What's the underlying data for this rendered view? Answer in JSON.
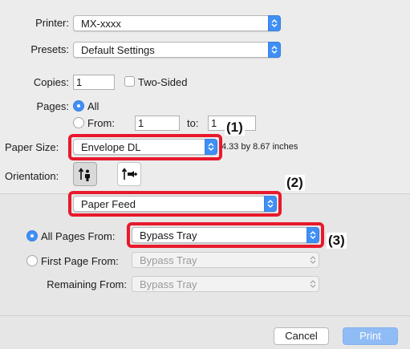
{
  "printer": {
    "label": "Printer:",
    "value": "MX-xxxx"
  },
  "presets": {
    "label": "Presets:",
    "value": "Default Settings"
  },
  "copies": {
    "label": "Copies:",
    "value": "1",
    "two_sided_label": "Two-Sided"
  },
  "pages": {
    "label": "Pages:",
    "all_label": "All",
    "from_label": "From:",
    "from_value": "1",
    "to_label": "to:",
    "to_value": "1"
  },
  "paper_size": {
    "label": "Paper Size:",
    "value": "Envelope DL",
    "dimensions": "4.33 by 8.67 inches"
  },
  "orientation": {
    "label": "Orientation:"
  },
  "panel_select": {
    "value": "Paper Feed"
  },
  "paper_feed": {
    "all_pages_label": "All Pages From:",
    "all_pages_value": "Bypass Tray",
    "first_page_label": "First Page From:",
    "first_page_value": "Bypass Tray",
    "remaining_label": "Remaining From:",
    "remaining_value": "Bypass Tray"
  },
  "callouts": {
    "c1": "(1)",
    "c2": "(2)",
    "c3": "(3)"
  },
  "buttons": {
    "cancel": "Cancel",
    "print": "Print"
  },
  "colors": {
    "accent": "#3f8ff5",
    "highlight": "#e8192c",
    "print_button": "#8fbcf5"
  }
}
